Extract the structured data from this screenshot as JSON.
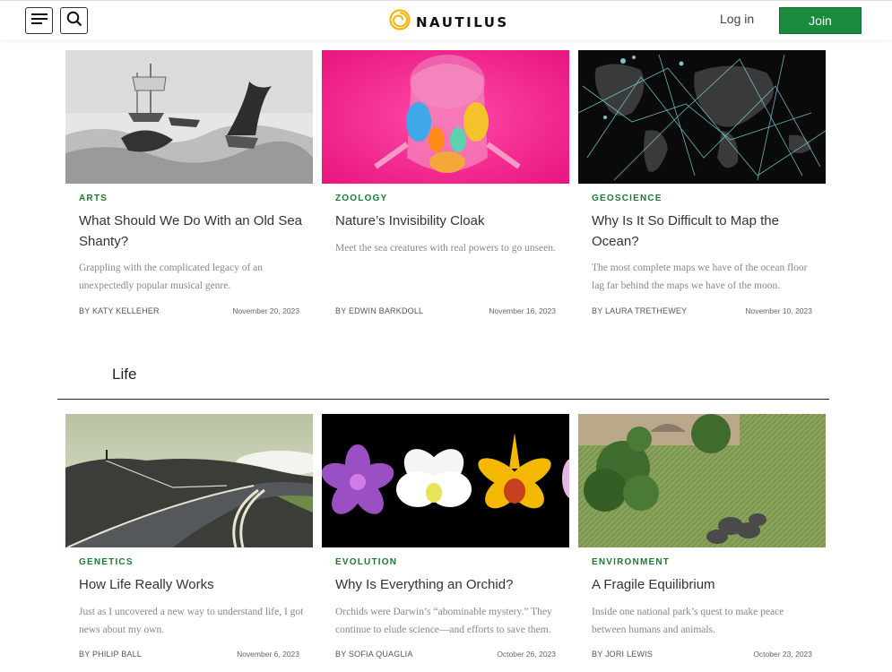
{
  "header": {
    "logo_text": "NAUTILUS",
    "login_label": "Log in",
    "join_label": "Join",
    "accent_color": "#1a8a3c",
    "menu_icon": "hamburger-icon",
    "search_icon": "search-icon"
  },
  "row1": [
    {
      "category": "ARTS",
      "title": "What Should We Do With an Old Sea Shanty?",
      "dek": "Grappling with the complicated legacy of an unexpectedly popular musical genre.",
      "byline": "BY KATY KELLEHER",
      "date": "November 20, 2023"
    },
    {
      "category": "ZOOLOGY",
      "title": "Nature’s Invisibility Cloak",
      "dek": "Meet the sea creatures with real powers to go unseen.",
      "byline": "BY EDWIN BARKDOLL",
      "date": "November 16, 2023"
    },
    {
      "category": "GEOSCIENCE",
      "title": "Why Is It So Difficult to Map the Ocean?",
      "dek": "The most complete maps we have of the ocean floor lag far behind the maps we have of the moon.",
      "byline": "BY LAURA TRETHEWEY",
      "date": "November 10, 2023"
    }
  ],
  "section": {
    "title": "Life"
  },
  "row2": [
    {
      "category": "GENETICS",
      "title": "How Life Really Works",
      "dek": "Just as I uncovered a new way to understand life, I got news about my own.",
      "byline": "BY PHILIP BALL",
      "date": "November 6, 2023"
    },
    {
      "category": "EVOLUTION",
      "title": "Why Is Everything an Orchid?",
      "dek": "Orchids were Darwin’s “abominable mystery.” They continue to elude science—and efforts to save them.",
      "byline": "BY SOFIA QUAGLIA",
      "date": "October 26, 2023"
    },
    {
      "category": "ENVIRONMENT",
      "title": "A Fragile Equilibrium",
      "dek": "Inside one national park’s quest to make peace between humans and animals.",
      "byline": "BY JORI LEWIS",
      "date": "October 23, 2023"
    }
  ]
}
